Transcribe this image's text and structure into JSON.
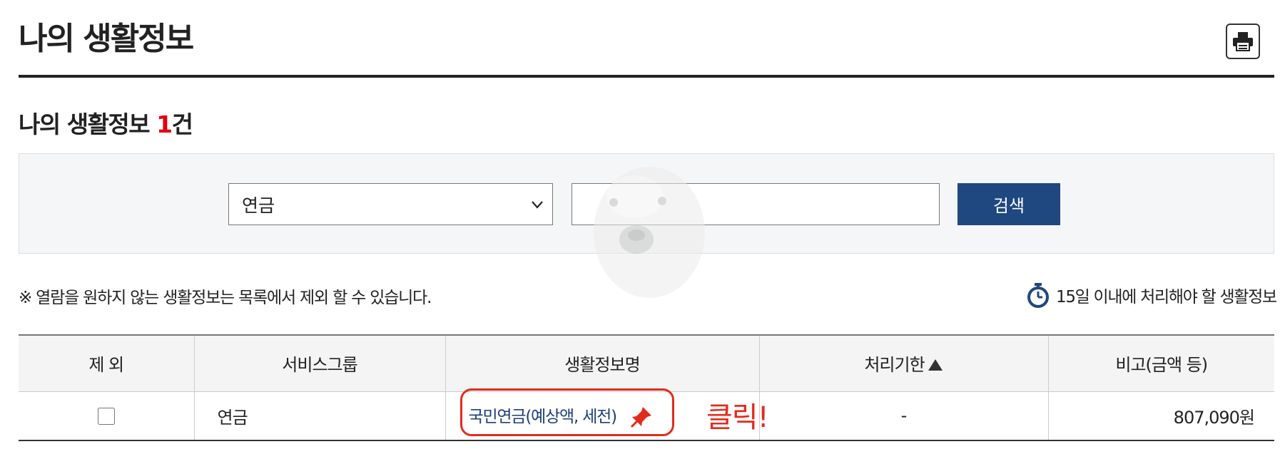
{
  "header": {
    "title": "나의 생활정보"
  },
  "summary": {
    "label": "나의 생활정보 ",
    "count": "1",
    "unit": "건"
  },
  "search": {
    "selected_option": "연금",
    "input_value": "",
    "button_label": "검색"
  },
  "notice": {
    "text": "※ 열람을 원하지 않는 생활정보는 목록에서 제외 할 수 있습니다."
  },
  "legend": {
    "deadline_text": "15일 이내에 처리해야 할 생활정보"
  },
  "table": {
    "headers": {
      "exclude": "제 외",
      "group": "서비스그룹",
      "name": "생활정보명",
      "deadline": "처리기한",
      "note": "비고(금액 등)"
    },
    "rows": [
      {
        "group": "연금",
        "name": "국민연금(예상액, 세전)",
        "deadline": "-",
        "note": "807,090원"
      }
    ]
  },
  "annotation": {
    "text": "클릭!"
  },
  "colors": {
    "primary_button": "#1f4780",
    "count_highlight": "#e3000f",
    "annotation": "#e32b1d",
    "link": "#1d3f7a"
  },
  "icons": [
    "print-icon",
    "chevron-down-icon",
    "stopwatch-icon",
    "sort-up-icon",
    "pin-icon"
  ]
}
